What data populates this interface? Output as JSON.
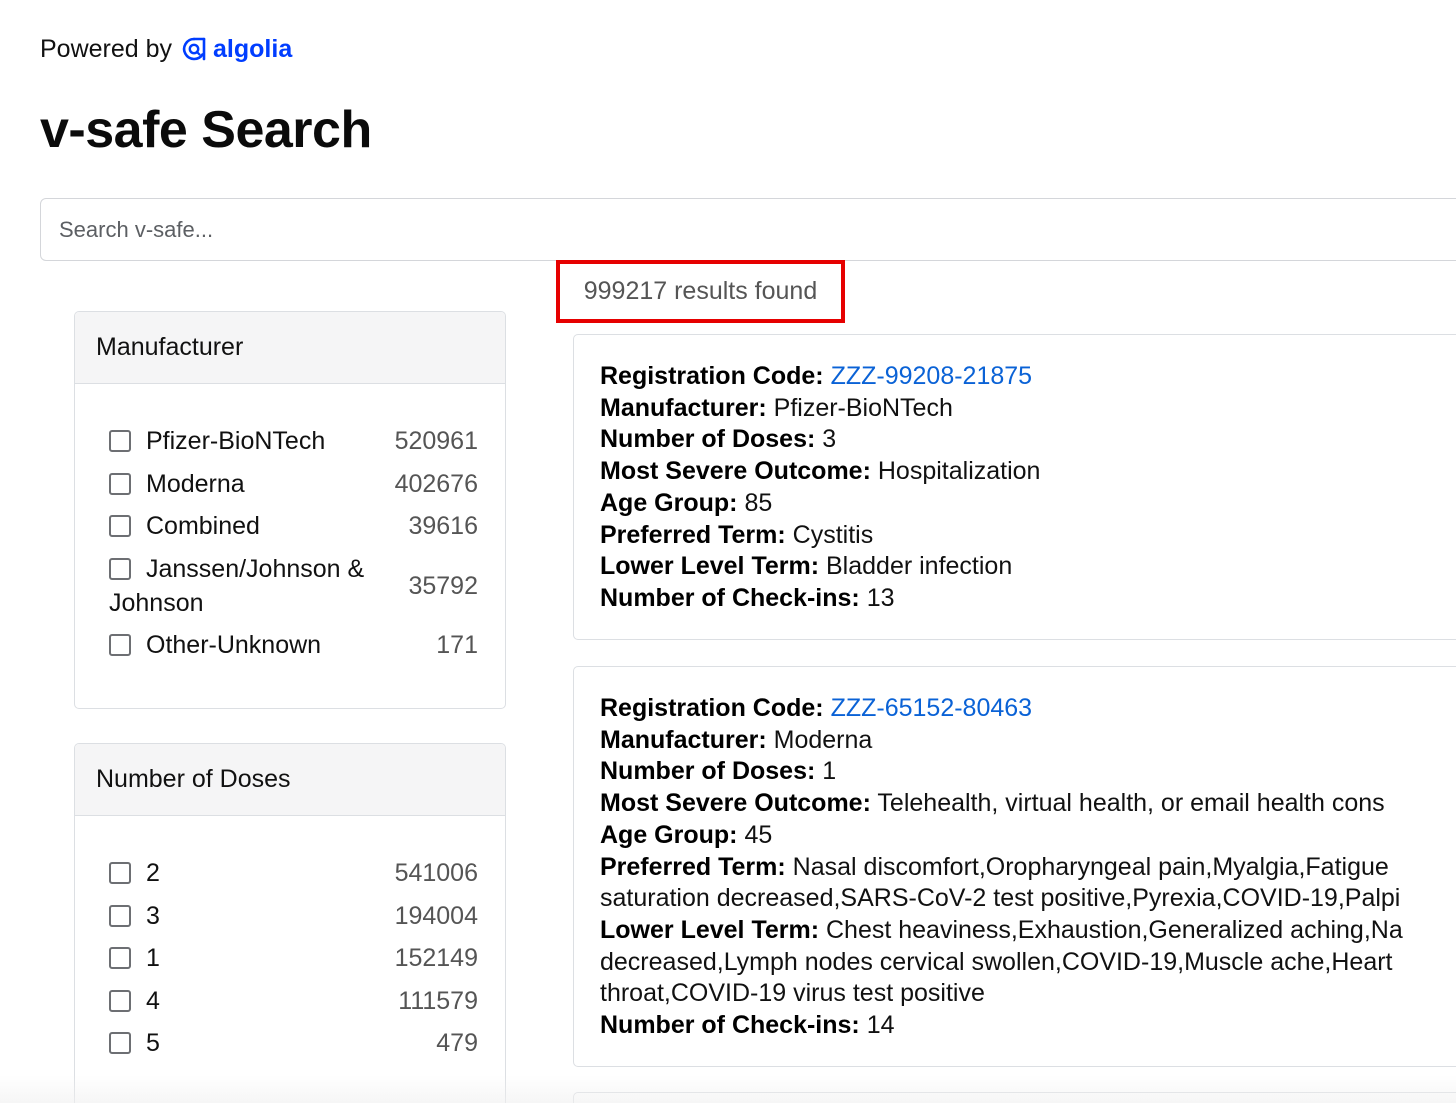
{
  "header": {
    "powered_by": "Powered by",
    "brand": "algolia",
    "title": "v-safe Search"
  },
  "search": {
    "placeholder": "Search v-safe..."
  },
  "results": {
    "count_text": "999217 results found"
  },
  "facets": {
    "manufacturer": {
      "title": "Manufacturer",
      "items": [
        {
          "label": "Pfizer-BioNTech",
          "count": "520961"
        },
        {
          "label": "Moderna",
          "count": "402676"
        },
        {
          "label": "Combined",
          "count": "39616"
        },
        {
          "label": "Janssen/Johnson & Johnson",
          "count": "35792"
        },
        {
          "label": "Other-Unknown",
          "count": "171"
        }
      ]
    },
    "doses": {
      "title": "Number of Doses",
      "items": [
        {
          "label": "2",
          "count": "541006"
        },
        {
          "label": "3",
          "count": "194004"
        },
        {
          "label": "1",
          "count": "152149"
        },
        {
          "label": "4",
          "count": "111579"
        },
        {
          "label": "5",
          "count": "479"
        }
      ]
    }
  },
  "field_labels": {
    "registration_code": "Registration Code:",
    "manufacturer": "Manufacturer:",
    "doses": "Number of Doses:",
    "outcome": "Most Severe Outcome:",
    "age_group": "Age Group:",
    "preferred_term": "Preferred Term:",
    "lower_level_term": "Lower Level Term:",
    "checkins": "Number of Check-ins:"
  },
  "hits": [
    {
      "registration_code": "ZZZ-99208-21875",
      "manufacturer": "Pfizer-BioNTech",
      "doses": "3",
      "outcome": "Hospitalization",
      "age_group": "85",
      "preferred_term": [
        "Cystitis"
      ],
      "lower_level_term": [
        "Bladder infection"
      ],
      "checkins": "13"
    },
    {
      "registration_code": "ZZZ-65152-80463",
      "manufacturer": "Moderna",
      "doses": "1",
      "outcome": "Telehealth, virtual health, or email health cons",
      "age_group": "45",
      "preferred_term": [
        "Nasal discomfort,Oropharyngeal pain,Myalgia,Fatigue",
        "saturation decreased,SARS-CoV-2 test positive,Pyrexia,COVID-19,Palpi"
      ],
      "lower_level_term": [
        "Chest heaviness,Exhaustion,Generalized aching,Na",
        "decreased,Lymph nodes cervical swollen,COVID-19,Muscle ache,Heart",
        "throat,COVID-19 virus test positive"
      ],
      "checkins": "14"
    }
  ]
}
